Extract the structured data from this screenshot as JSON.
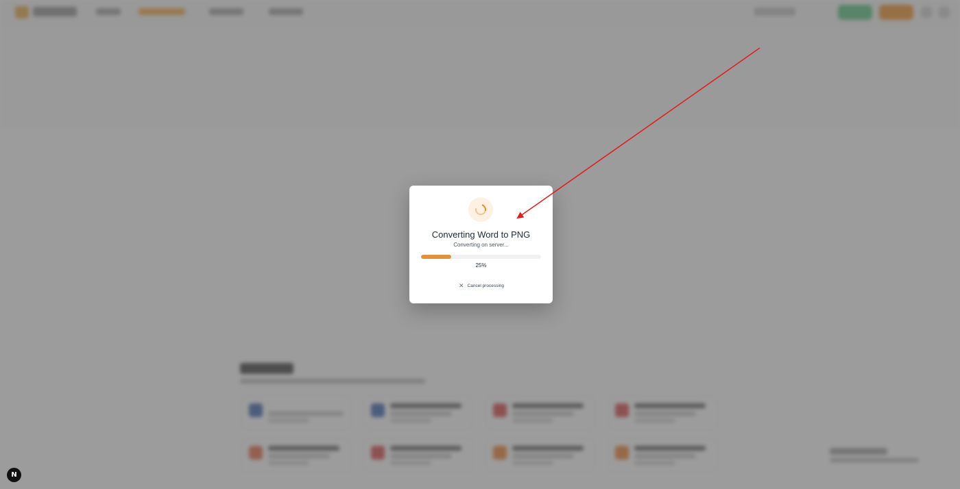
{
  "modal": {
    "title": "Converting Word to PNG",
    "status": "Converting on server...",
    "progress_percent": 25,
    "progress_label": "25%",
    "cancel_label": "Cancel processing",
    "cancel_icon": "close-icon",
    "spinner_icon": "spinner-icon"
  },
  "badge": {
    "label": "N"
  },
  "colors": {
    "accent": "#f08a1c",
    "progress": "#e4923a",
    "annotation_arrow": "#e02020",
    "overlay": "#5f5f5f"
  }
}
